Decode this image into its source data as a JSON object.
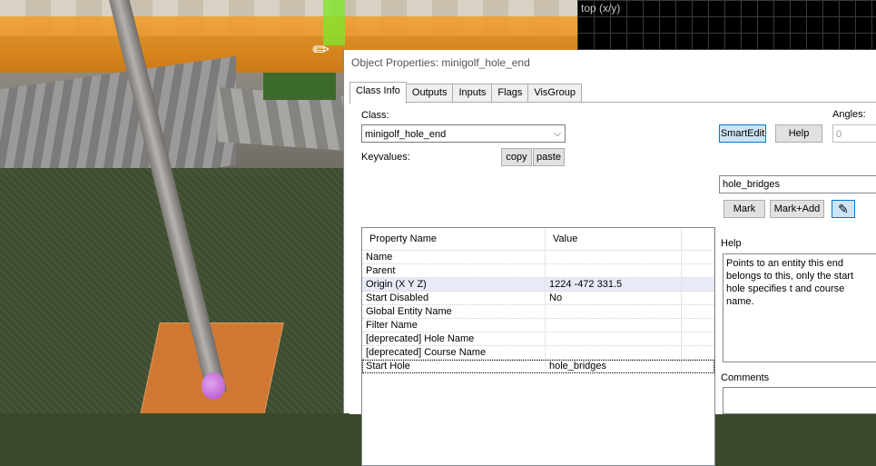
{
  "viewport_2d": {
    "label": "top (x/y)"
  },
  "dialog": {
    "title": "Object Properties: minigolf_hole_end",
    "tabs": [
      "Class Info",
      "Outputs",
      "Inputs",
      "Flags",
      "VisGroup"
    ],
    "class_label": "Class:",
    "class_value": "minigolf_hole_end",
    "keyvalues_label": "Keyvalues:",
    "copy_label": "copy",
    "paste_label": "paste",
    "smartedit_label": "SmartEdit",
    "help_button_label": "Help",
    "angles_label": "Angles:",
    "angles_value": "0",
    "columns": {
      "name": "Property Name",
      "value": "Value"
    },
    "rows": [
      {
        "name": "Name",
        "value": ""
      },
      {
        "name": "Parent",
        "value": ""
      },
      {
        "name": "Origin (X Y Z)",
        "value": "1224 -472 331.5"
      },
      {
        "name": "Start Disabled",
        "value": "No"
      },
      {
        "name": "Global Entity Name",
        "value": ""
      },
      {
        "name": "Filter Name",
        "value": ""
      },
      {
        "name": "[deprecated] Hole Name",
        "value": ""
      },
      {
        "name": "[deprecated] Course Name",
        "value": ""
      },
      {
        "name": "Start Hole",
        "value": "hole_bridges"
      }
    ],
    "value_field": "hole_bridges",
    "mark_label": "Mark",
    "mark_add_label": "Mark+Add",
    "help_label": "Help",
    "help_text": "Points to an entity this end belongs to this, only the start hole specifies t and course name.",
    "comments_label": "Comments"
  }
}
